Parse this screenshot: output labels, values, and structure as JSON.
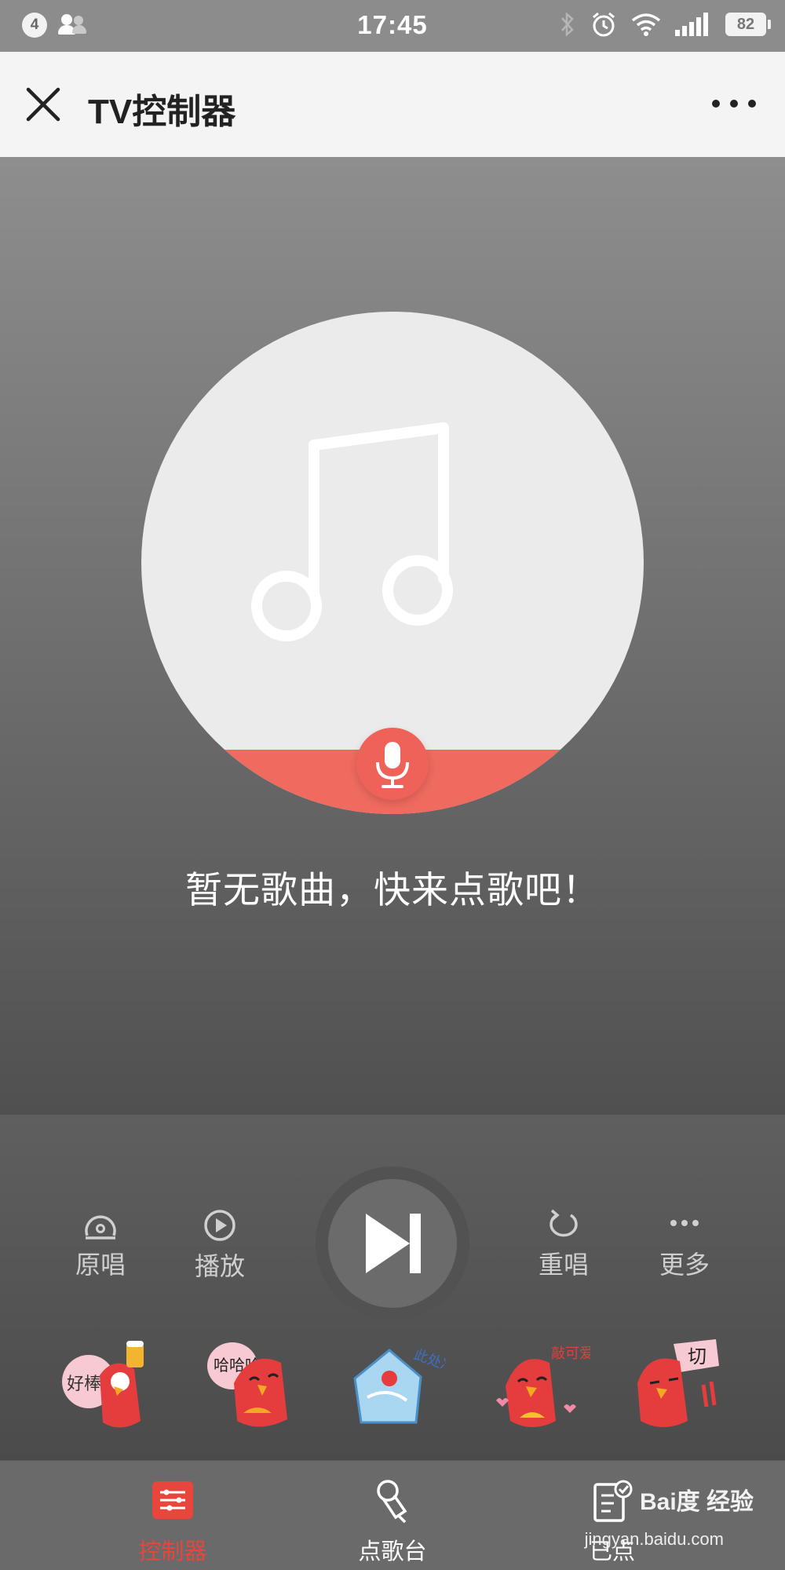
{
  "status_bar": {
    "notification_count": "4",
    "time": "17:45",
    "battery": "82",
    "icons": [
      "people-icon",
      "bluetooth-icon",
      "alarm-icon",
      "wifi-icon",
      "signal-icon",
      "battery-icon"
    ]
  },
  "header": {
    "title": "TV控制器",
    "close_icon": "close-icon",
    "more_icon": "more-dots-icon"
  },
  "player": {
    "artwork_icon": "music-note-icon",
    "mic_icon": "microphone-icon",
    "empty_message": "暂无歌曲，快来点歌吧！"
  },
  "controls": {
    "original": "原唱",
    "play": "播放",
    "next_icon": "next-track-icon",
    "replay": "重唱",
    "more": "更多"
  },
  "stickers": [
    {
      "name": "sticker-great",
      "text": "好棒"
    },
    {
      "name": "sticker-haha",
      "text": "哈哈哈"
    },
    {
      "name": "sticker-cold",
      "text": "此处冷场…"
    },
    {
      "name": "sticker-cute",
      "text": "敲可爱"
    },
    {
      "name": "sticker-cut",
      "text": "切"
    }
  ],
  "tabbar": {
    "controller": "控制器",
    "song_request": "点歌台",
    "requested": "已点",
    "active_color": "#e8453c"
  },
  "watermark": {
    "brand": "Bai度 经验",
    "url": "jingyan.baidu.com"
  }
}
